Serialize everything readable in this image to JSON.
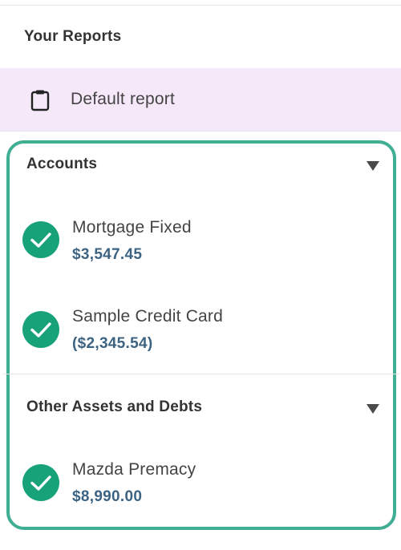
{
  "reports": {
    "section_title": "Your Reports",
    "default_report_label": "Default report"
  },
  "groups": [
    {
      "title": "Accounts",
      "items": [
        {
          "name": "Mortgage Fixed",
          "value": "$3,547.45"
        },
        {
          "name": "Sample Credit Card",
          "value": "($2,345.54)"
        }
      ]
    },
    {
      "title": "Other Assets and Debts",
      "items": [
        {
          "name": "Mazda Premacy",
          "value": "$8,990.00"
        }
      ]
    }
  ],
  "colors": {
    "accent_border": "#3fae93",
    "check_fill": "#18a27a",
    "highlight_bg": "#f5e8f9",
    "value_text": "#3d6382"
  },
  "icons": {
    "report": "clipboard-icon",
    "selected": "checkmark-circle-icon",
    "collapse": "triangle-down-icon"
  }
}
